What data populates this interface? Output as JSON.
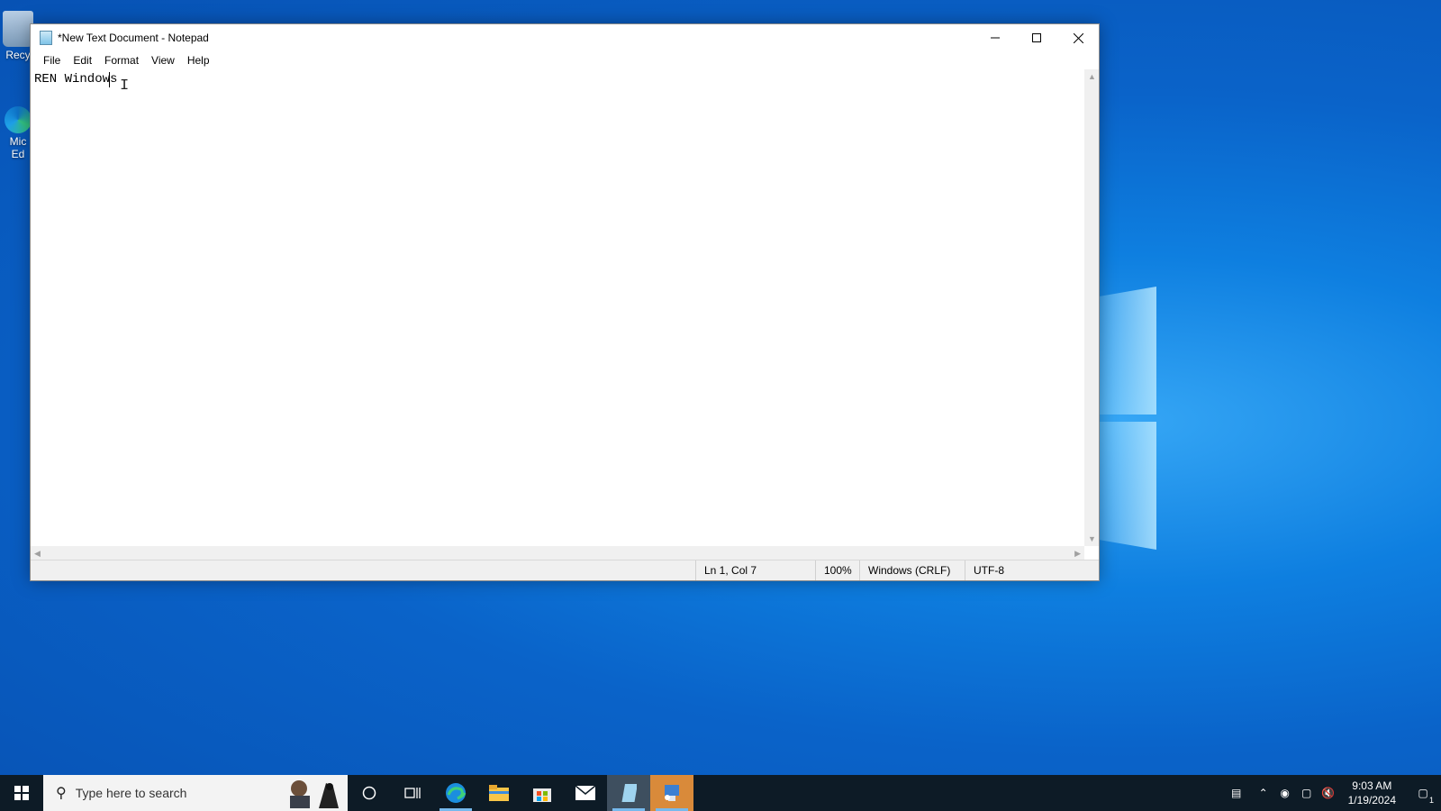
{
  "desktop": {
    "recycle_bin_label": "Recy",
    "edge_label_1": "Mic",
    "edge_label_2": "Ed"
  },
  "notepad": {
    "title": "*New Text Document - Notepad",
    "menu": [
      "File",
      "Edit",
      "Format",
      "View",
      "Help"
    ],
    "content": "REN Windows",
    "status": {
      "position": "Ln 1, Col 7",
      "zoom": "100%",
      "line_ending": "Windows (CRLF)",
      "encoding": "UTF-8"
    }
  },
  "taskbar": {
    "search_placeholder": "Type here to search",
    "apps": [
      "cortana-icon",
      "task-view-icon",
      "edge-icon",
      "file-explorer-icon",
      "store-icon",
      "mail-icon",
      "notepad-icon",
      "control-panel-icon"
    ],
    "time": "9:03 AM",
    "date": "1/19/2024",
    "notification_count": "1"
  },
  "colors": {
    "taskbar_bg": "#0d1b26",
    "active_indicator": "#76b9ed",
    "desktop_blue": "#0a63c9"
  }
}
